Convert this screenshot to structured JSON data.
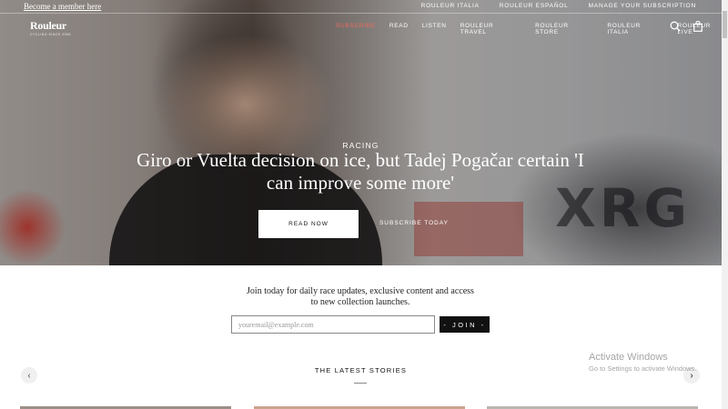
{
  "topbar": {
    "member_link": "Become a member here",
    "links": [
      "Rouleur Italia",
      "Rouleur Español",
      "Manage your subscription"
    ]
  },
  "logo": {
    "wordmark": "Rouleur",
    "tagline": "CYCLING SINCE 2006"
  },
  "nav": {
    "items": [
      "Subscribe",
      "Read",
      "Listen",
      "Rouleur Travel",
      "Rouleur Store",
      "Rouleur Italia",
      "Rouleur Live"
    ],
    "accent_color": "#ee6b5a"
  },
  "icons": {
    "search": "search-icon",
    "bag": "shopping-bag-icon"
  },
  "hero": {
    "kicker": "Racing",
    "headline": "Giro or Vuelta decision on ice, but Tadej Pogačar certain 'I can improve some more'",
    "read_button": "Read now",
    "subscribe_link": "Subscribe today"
  },
  "newsletter": {
    "text": "Join today for daily race updates, exclusive content and access to new collection launches.",
    "placeholder": "youremail@example.com",
    "value": "",
    "button": "- JOIN -"
  },
  "latest": {
    "title": "The Latest Stories",
    "prev_icon": "chevron-left-icon",
    "next_icon": "chevron-right-icon"
  },
  "watermark": {
    "title": "Activate Windows",
    "subtitle": "Go to Settings to activate Windows."
  }
}
